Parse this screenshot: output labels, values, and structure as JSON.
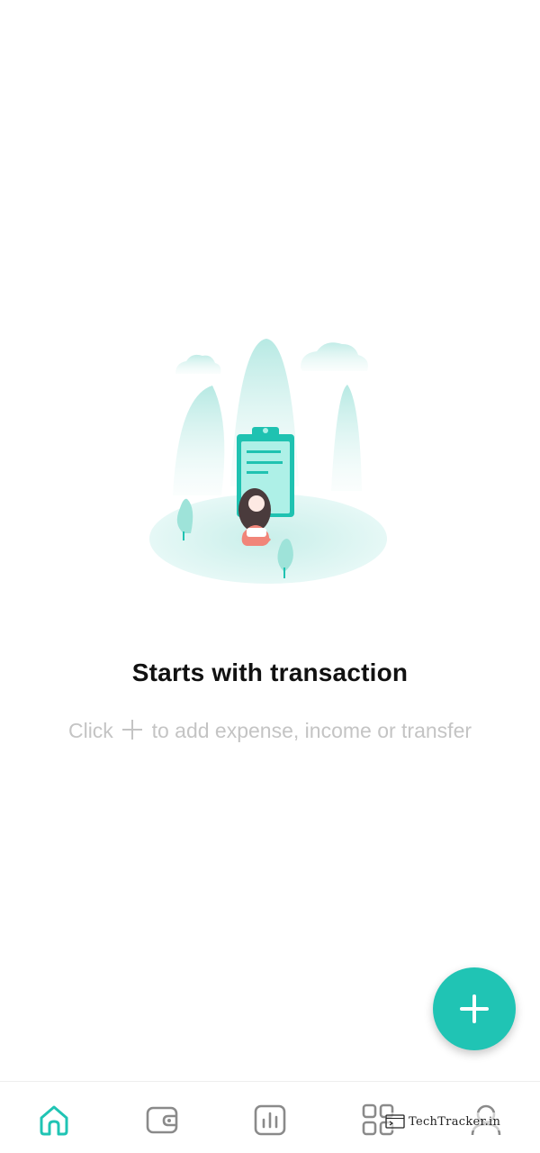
{
  "empty_state": {
    "title": "Starts with transaction",
    "subtitle_before": "Click",
    "subtitle_after": "to add expense, income or transfer"
  },
  "fab": {
    "icon": "plus-icon"
  },
  "bottom_nav": {
    "items": [
      {
        "icon": "home-icon",
        "active": true
      },
      {
        "icon": "wallet-icon",
        "active": false
      },
      {
        "icon": "statistics-icon",
        "active": false
      },
      {
        "icon": "grid-icon",
        "active": false
      },
      {
        "icon": "profile-icon",
        "active": false
      }
    ]
  },
  "watermark": {
    "text": "TechTracker.in"
  },
  "colors": {
    "accent": "#20c4b4",
    "inactive_icon": "#8a8a8a",
    "subtitle": "#c4c4c4"
  }
}
